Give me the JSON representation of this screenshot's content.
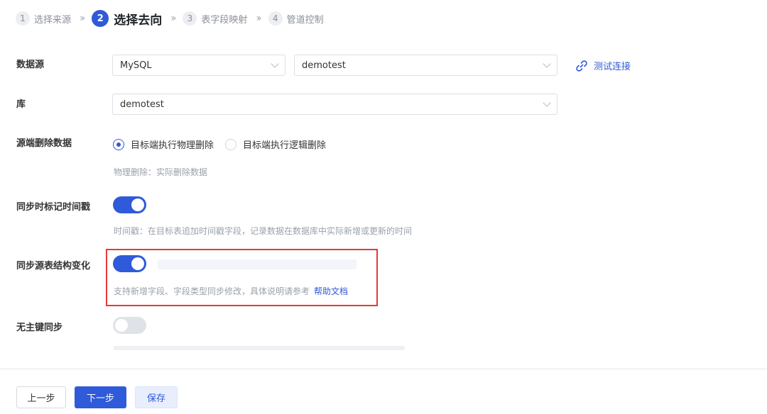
{
  "steps": [
    {
      "num": "1",
      "label": "选择来源"
    },
    {
      "num": "2",
      "label": "选择去向"
    },
    {
      "num": "3",
      "label": "表字段映射"
    },
    {
      "num": "4",
      "label": "管道控制"
    }
  ],
  "step_separator": "»",
  "form": {
    "datasource": {
      "label": "数据源",
      "type_value": "MySQL",
      "instance_value": "demotest",
      "test_link": "测试连接"
    },
    "database": {
      "label": "库",
      "value": "demotest"
    },
    "delete_data": {
      "label": "源端删除数据",
      "option_physical": "目标端执行物理删除",
      "option_logical": "目标端执行逻辑删除",
      "selected": "physical",
      "hint": "物理删除：实际删除数据"
    },
    "sync_timestamp": {
      "label": "同步时标记时间戳",
      "enabled": true,
      "hint": "时间戳：在目标表追加时间戳字段，记录数据在数据库中实际新增或更新的时间"
    },
    "sync_schema": {
      "label": "同步源表结构变化",
      "enabled": true,
      "hint": "支持新增字段、字段类型同步修改，具体说明请参考",
      "help_link": "帮助文档"
    },
    "no_pk_sync": {
      "label": "无主键同步",
      "enabled": false
    }
  },
  "footer": {
    "prev": "上一步",
    "next": "下一步",
    "save": "保存"
  },
  "colors": {
    "accent": "#2f5ad9",
    "highlight": "#e23a3a"
  }
}
